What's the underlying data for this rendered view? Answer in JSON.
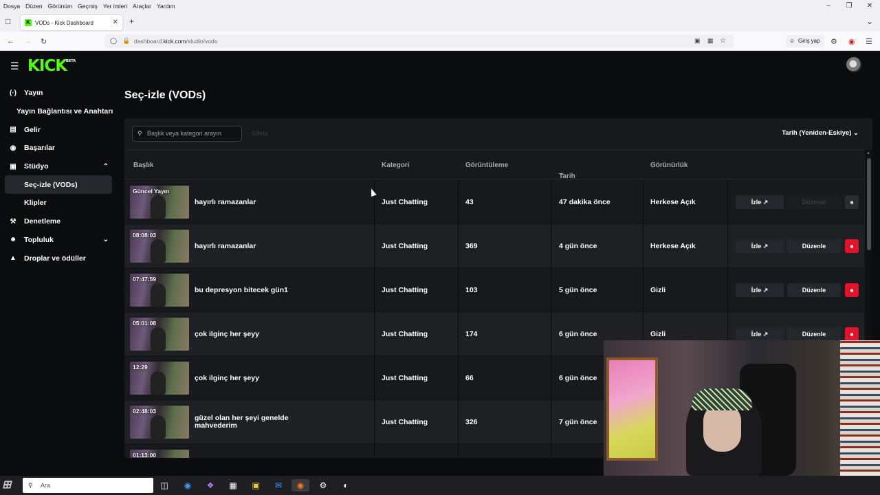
{
  "menubar": [
    "Dosya",
    "Düzen",
    "Görünüm",
    "Geçmiş",
    "Yer imleri",
    "Araçlar",
    "Yardım"
  ],
  "browser": {
    "tab_title": "VODs - Kick Dashboard",
    "url_prefix": "dashboard.",
    "url_domain": "kick.com",
    "url_path": "/studio/vods",
    "login_label": "Giriş yap"
  },
  "app": {
    "logo": "KICK",
    "logo_badge": "BETA",
    "page_title": "Seç-izle (VODs)",
    "search_placeholder": "Başlık veya kategori arayın",
    "ghost_label": "Sıfırla",
    "sort_label": "Tarih (Yeniden-Eskiye)"
  },
  "sidebar": {
    "items": [
      {
        "label": "Yayın",
        "icon": "broadcast-icon"
      },
      {
        "label": "Yayın Bağlantısı ve Anahtarı"
      },
      {
        "label": "Gelir",
        "icon": "chart-icon"
      },
      {
        "label": "Başarılar",
        "icon": "trophy-icon"
      },
      {
        "label": "Stüdyo",
        "icon": "studio-icon"
      },
      {
        "label": "Seç-izle (VODs)"
      },
      {
        "label": "Klipler"
      },
      {
        "label": "Denetleme",
        "icon": "wrench-icon"
      },
      {
        "label": "Topluluk",
        "icon": "community-icon"
      },
      {
        "label": "Droplar ve ödüller",
        "icon": "cake-icon"
      }
    ]
  },
  "table": {
    "columns": [
      "Başlık",
      "Kategori",
      "Görüntüleme",
      "Tarih",
      "Görünürlük"
    ],
    "date_sort_arrow": "⌃",
    "watch_label": "İzle",
    "edit_label": "Düzenle",
    "rows": [
      {
        "duration": "Güncel Yayın",
        "title": "hayırlı ramazanlar",
        "category": "Just Chatting",
        "views": "43",
        "date": "47 dakika önce",
        "visibility": "Herkese Açık",
        "edit_disabled": true
      },
      {
        "duration": "08:08:03",
        "title": "hayırlı ramazanlar",
        "category": "Just Chatting",
        "views": "369",
        "date": "4 gün önce",
        "visibility": "Herkese Açık"
      },
      {
        "duration": "07:47:59",
        "title": "bu depresyon bitecek gün1",
        "category": "Just Chatting",
        "views": "103",
        "date": "5 gün önce",
        "visibility": "Gizli"
      },
      {
        "duration": "05:01:08",
        "title": "çok ilginç her şeyy",
        "category": "Just Chatting",
        "views": "174",
        "date": "6 gün önce",
        "visibility": "Gizli"
      },
      {
        "duration": "12:29",
        "title": "çok ilginç her şeyy",
        "category": "Just Chatting",
        "views": "66",
        "date": "6 gün önce",
        "visibility": ""
      },
      {
        "duration": "02:48:03",
        "title": "güzel olan her şeyi genelde mahvederim",
        "category": "Just Chatting",
        "views": "326",
        "date": "7 gün önce",
        "visibility": ""
      },
      {
        "duration": "01:13:00",
        "title": "",
        "category": "",
        "views": "",
        "date": "",
        "visibility": ""
      }
    ]
  },
  "taskbar": {
    "search_text": "Ara"
  },
  "colors": {
    "brand": "#53fc18",
    "danger": "#e5132a"
  }
}
